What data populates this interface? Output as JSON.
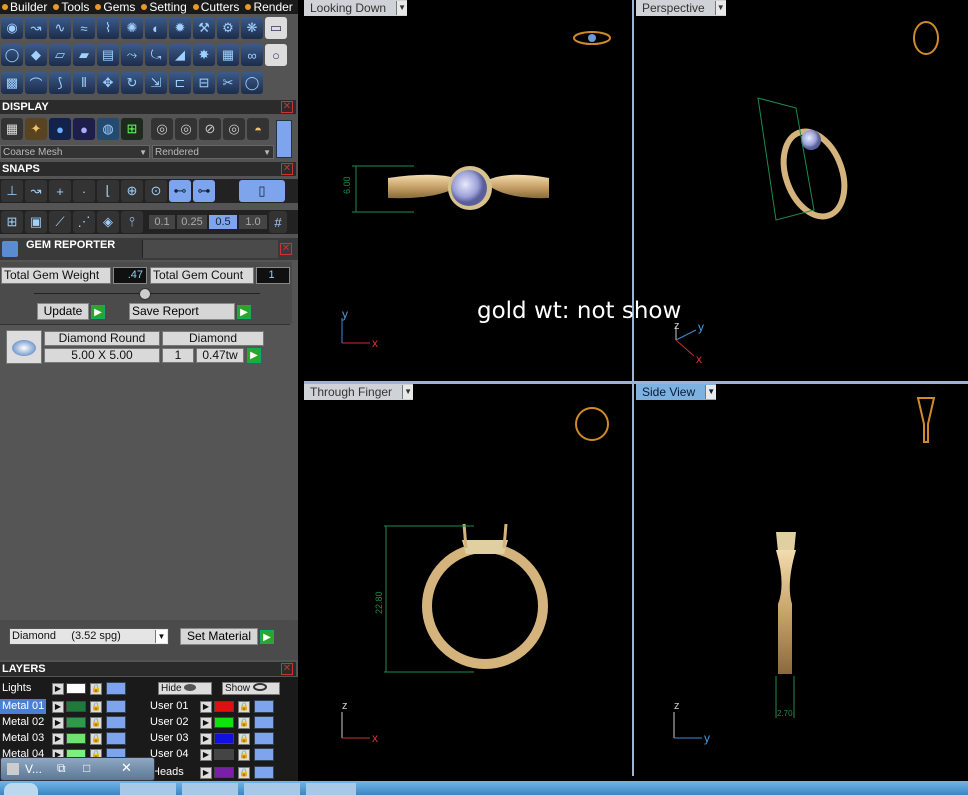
{
  "menubar": {
    "items": [
      "Builder",
      "Tools",
      "Gems",
      "Setting",
      "Cutters",
      "Render"
    ]
  },
  "display": {
    "title": "DISPLAY",
    "mesh_select": "Coarse Mesh",
    "render_select": "Rendered"
  },
  "snaps": {
    "title": "SNAPS",
    "values": [
      "0.1",
      "0.25",
      "0.5",
      "1.0"
    ],
    "active_value": "0.5"
  },
  "gem_reporter": {
    "title": "GEM REPORTER",
    "total_weight_label": "Total Gem Weight",
    "total_weight_value": ".47",
    "total_count_label": "Total Gem Count",
    "total_count_value": "1",
    "update_label": "Update",
    "save_report_label": "Save Report",
    "table_header_1": "Diamond Round",
    "table_header_2": "Diamond",
    "row_size": "5.00 X 5.00",
    "row_count": "1",
    "row_tw": "0.47tw",
    "material_select": "Diamond     (3.52 spg)",
    "set_material_label": "Set Material"
  },
  "layers": {
    "title": "LAYERS",
    "lights_label": "Lights",
    "hide_label": "Hide",
    "show_label": "Show",
    "left_rows": [
      {
        "label": "Metal 01",
        "color": "#1f7a3a"
      },
      {
        "label": "Metal 02",
        "color": "#2e9a49"
      },
      {
        "label": "Metal 03",
        "color": "#6fe36f"
      },
      {
        "label": "Metal 04",
        "color": "#7cf07c"
      }
    ],
    "right_rows": [
      {
        "label": "User 01",
        "color": "#e01010"
      },
      {
        "label": "User 02",
        "color": "#11e011"
      },
      {
        "label": "User 03",
        "color": "#1010e0"
      },
      {
        "label": "User 04",
        "color": "#444444"
      },
      {
        "label": "Heads",
        "color": "#7a1fa8"
      }
    ]
  },
  "mini_window": {
    "title": "V..."
  },
  "viewports": {
    "top_left": {
      "label": "Looking Down",
      "dimension": "6.00"
    },
    "top_right": {
      "label": "Perspective"
    },
    "bottom_left": {
      "label": "Through Finger",
      "dimension": "22.80"
    },
    "bottom_right": {
      "label": "Side View",
      "dimension": "2.70"
    }
  },
  "overlay_note": "gold wt: not show",
  "axes": {
    "x": "x",
    "y": "y",
    "z": "z"
  }
}
